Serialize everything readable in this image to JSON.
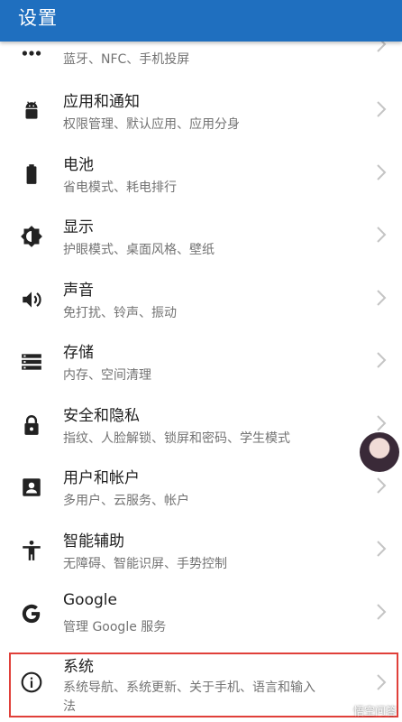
{
  "appbar": {
    "title": "设置"
  },
  "rows": [
    {
      "title": "",
      "subtitle": "蓝牙、NFC、手机投屏",
      "icon": "more-connections-icon"
    },
    {
      "title": "应用和通知",
      "subtitle": "权限管理、默认应用、应用分身",
      "icon": "android-icon"
    },
    {
      "title": "电池",
      "subtitle": "省电模式、耗电排行",
      "icon": "battery-icon"
    },
    {
      "title": "显示",
      "subtitle": "护眼模式、桌面风格、壁纸",
      "icon": "brightness-icon"
    },
    {
      "title": "声音",
      "subtitle": "免打扰、铃声、振动",
      "icon": "volume-icon"
    },
    {
      "title": "存储",
      "subtitle": "内存、空间清理",
      "icon": "storage-icon"
    },
    {
      "title": "安全和隐私",
      "subtitle": "指纹、人脸解锁、锁屏和密码、学生模式",
      "icon": "lock-icon"
    },
    {
      "title": "用户和帐户",
      "subtitle": "多用户、云服务、帐户",
      "icon": "account-icon"
    },
    {
      "title": "智能辅助",
      "subtitle": "无障碍、智能识屏、手势控制",
      "icon": "accessibility-icon"
    },
    {
      "title": "Google",
      "subtitle": "管理 Google 服务",
      "icon": "google-icon"
    },
    {
      "title": "系统",
      "subtitle": "系统导航、系统更新、关于手机、语言和输入",
      "subtitle_cont": "法",
      "icon": "info-icon"
    }
  ],
  "watermark": "悟空问答",
  "colors": {
    "appbar": "#1f6fbf",
    "highlight": "#e0403a"
  }
}
